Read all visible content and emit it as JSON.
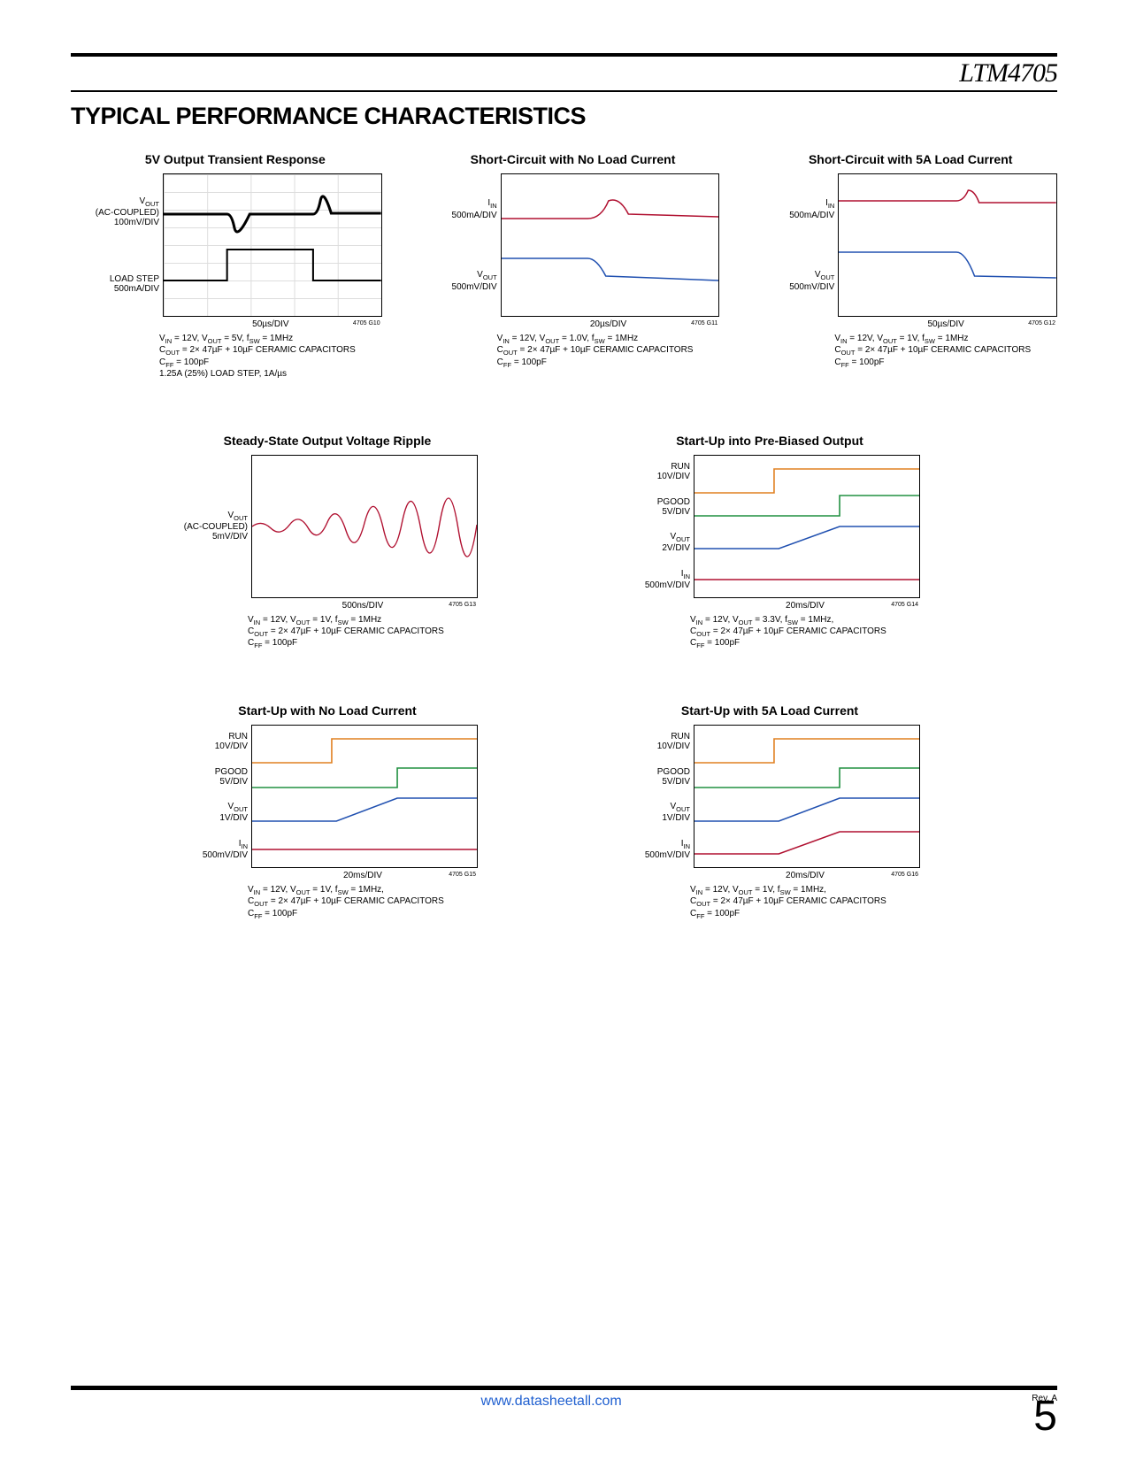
{
  "header": {
    "part": "LTM4705"
  },
  "section_title": "TYPICAL PERFORMANCE CHARACTERISTICS",
  "footer": {
    "link": "www.datasheetall.com",
    "rev": "Rev. A",
    "page": "5"
  },
  "charts": [
    {
      "title": "5V Output Transient Response",
      "y": [
        {
          "t": "V<sub>OUT</sub><br>(AC-COUPLED)<br>100mV/DIV"
        },
        {
          "t": "LOAD STEP<br>500mA/DIV"
        }
      ],
      "x": "50µs/DIV",
      "fid": "4705 G10",
      "cond": "V<sub>IN</sub> = 12V, V<sub>OUT</sub> = 5V, f<sub>SW</sub> = 1MHz<br>C<sub>OUT</sub> = 2× 47µF + 10µF CERAMIC CAPACITORS<br>C<sub>FF</sub> = 100pF<br>1.25A (25%) LOAD STEP, 1A/µs",
      "grid": true,
      "svg": "<path fill='none' stroke='#000' stroke-width='3' d='M0,45 L70,45 Q75,45 78,60 T95,45 L165,45 Q170,45 173,30 T185,44 L240,44'/><path fill='none' stroke='#000' stroke-width='2' d='M0,120 L70,120 L70,85 L165,85 L165,120 L240,120'/>"
    },
    {
      "title": "Short-Circuit with No Load Current",
      "y": [
        {
          "t": "I<sub>IN</sub><br>500mA/DIV"
        },
        {
          "t": "V<sub>OUT</sub><br>500mV/DIV"
        }
      ],
      "x": "20µs/DIV",
      "fid": "4705 G11",
      "cond": "V<sub>IN</sub> = 12V, V<sub>OUT</sub> = 1.0V, f<sub>SW</sub> = 1MHz<br>C<sub>OUT</sub> = 2× 47µF + 10µF CERAMIC CAPACITORS<br>C<sub>FF</sub> = 100pF",
      "svg": "<path fill='none' stroke='#B01030' stroke-width='1.5' d='M0,50 L95,50 Q110,50 118,30 Q130,25 140,45 L240,48'/><path fill='none' stroke='#2050B0' stroke-width='1.5' d='M0,95 L95,95 Q105,95 115,115 L240,120'/>"
    },
    {
      "title": "Short-Circuit with 5A Load Current",
      "y": [
        {
          "t": "I<sub>IN</sub><br>500mA/DIV"
        },
        {
          "t": "V<sub>OUT</sub><br>500mV/DIV"
        }
      ],
      "x": "50µs/DIV",
      "fid": "4705 G12",
      "cond": "V<sub>IN</sub> = 12V, V<sub>OUT</sub> = 1V, f<sub>SW</sub> = 1MHz<br>C<sub>OUT</sub> = 2× 47µF + 10µF CERAMIC CAPACITORS<br>C<sub>FF</sub> = 100pF",
      "svg": "<path fill='none' stroke='#B01030' stroke-width='1.5' d='M0,30 L130,30 Q138,30 143,18 Q150,18 155,32 L240,32'/><path fill='none' stroke='#2050B0' stroke-width='1.5' d='M0,88 L130,88 Q140,88 150,115 L240,117'/>"
    },
    {
      "title": "Steady-State Output Voltage Ripple",
      "y": [
        {
          "t": "V<sub>OUT</sub><br>(AC-COUPLED)<br>5mV/DIV"
        }
      ],
      "x": "500ns/DIV",
      "fid": "4705 G13",
      "cond": "V<sub>IN</sub> = 12V, V<sub>OUT</sub> = 1V, f<sub>SW</sub> = 1MHz<br>C<sub>OUT</sub> = 2× 47µF + 10µF CERAMIC CAPACITORS<br>C<sub>FF</sub> = 100pF",
      "svg": "<path fill='none' stroke='#B01030' stroke-width='1.3' d='M0,80 Q10,72 20,82 T40,78 T60,82 T80,76 T100,84 T120,76 T140,82 T160,76 T180,82 T200,78 T220,82 T240,78'/>"
    },
    {
      "title": "Start-Up into Pre-Biased Output",
      "y": [
        {
          "t": "RUN<br>10V/DIV"
        },
        {
          "t": "PGOOD<br>5V/DIV"
        },
        {
          "t": "V<sub>OUT</sub><br>2V/DIV"
        },
        {
          "t": "I<sub>IN</sub><br>500mV/DIV"
        }
      ],
      "x": "20ms/DIV",
      "fid": "4705 G14",
      "cond": "V<sub>IN</sub> = 12V, V<sub>OUT</sub> = 3.3V, f<sub>SW</sub> = 1MHz,<br>C<sub>OUT</sub> = 2× 47µF + 10µF CERAMIC CAPACITORS<br>C<sub>FF</sub> = 100pF",
      "svg": "<path fill='none' stroke='#E08020' stroke-width='1.5' d='M0,42 L85,42 L85,15 L240,15'/><path fill='none' stroke='#209040' stroke-width='1.5' d='M0,68 L155,68 L155,45 L240,45'/><path fill='none' stroke='#2050B0' stroke-width='1.5' d='M0,105 L90,105 L155,80 L240,80'/><path fill='none' stroke='#B01030' stroke-width='1.5' d='M0,140 L240,140'/>"
    },
    {
      "title": "Start-Up with No Load Current",
      "y": [
        {
          "t": "RUN<br>10V/DIV"
        },
        {
          "t": "PGOOD<br>5V/DIV"
        },
        {
          "t": "V<sub>OUT</sub><br>1V/DIV"
        },
        {
          "t": "I<sub>IN</sub><br>500mV/DIV"
        }
      ],
      "x": "20ms/DIV",
      "fid": "4705 G15",
      "cond": "V<sub>IN</sub> = 12V, V<sub>OUT</sub> = 1V, f<sub>SW</sub> = 1MHz,<br>C<sub>OUT</sub> = 2× 47µF + 10µF CERAMIC CAPACITORS<br>C<sub>FF</sub> = 100pF",
      "svg": "<path fill='none' stroke='#E08020' stroke-width='1.5' d='M0,42 L85,42 L85,15 L240,15'/><path fill='none' stroke='#209040' stroke-width='1.5' d='M0,70 L155,70 L155,48 L240,48'/><path fill='none' stroke='#2050B0' stroke-width='1.5' d='M0,108 L90,108 L155,82 L240,82'/><path fill='none' stroke='#B01030' stroke-width='1.5' d='M0,140 L240,140'/>"
    },
    {
      "title": "Start-Up with 5A Load Current",
      "y": [
        {
          "t": "RUN<br>10V/DIV"
        },
        {
          "t": "PGOOD<br>5V/DIV"
        },
        {
          "t": "V<sub>OUT</sub><br>1V/DIV"
        },
        {
          "t": "I<sub>IN</sub><br>500mV/DIV"
        }
      ],
      "x": "20ms/DIV",
      "fid": "4705 G16",
      "cond": "V<sub>IN</sub> = 12V, V<sub>OUT</sub> = 1V, f<sub>SW</sub> = 1MHz,<br>C<sub>OUT</sub> = 2× 47µF + 10µF CERAMIC CAPACITORS<br>C<sub>FF</sub> = 100pF",
      "svg": "<path fill='none' stroke='#E08020' stroke-width='1.5' d='M0,42 L85,42 L85,15 L240,15'/><path fill='none' stroke='#209040' stroke-width='1.5' d='M0,70 L155,70 L155,48 L240,48'/><path fill='none' stroke='#2050B0' stroke-width='1.5' d='M0,108 L90,108 L155,82 L240,82'/><path fill='none' stroke='#B01030' stroke-width='1.5' d='M0,145 L90,145 L155,120 L240,120'/>"
    }
  ],
  "chart_data": [
    {
      "type": "line",
      "title": "5V Output Transient Response",
      "xlabel": "50µs/DIV",
      "series": [
        {
          "name": "VOUT (AC-COUPLED) 100mV/DIV",
          "y_baseline": 0,
          "dip_mV": -100,
          "overshoot_mV": 70
        },
        {
          "name": "LOAD STEP 500mA/DIV",
          "y_low": 0,
          "y_high": 1.25,
          "unit": "A"
        }
      ],
      "conditions": {
        "VIN": "12V",
        "VOUT": "5V",
        "fSW": "1MHz",
        "COUT": "2×47µF+10µF ceramic",
        "CFF": "100pF",
        "load_step": "1.25A (25%) 1A/µs"
      }
    },
    {
      "type": "line",
      "title": "Short-Circuit with No Load Current",
      "xlabel": "20µs/DIV",
      "series": [
        {
          "name": "IIN 500mA/DIV"
        },
        {
          "name": "VOUT 500mV/DIV"
        }
      ],
      "conditions": {
        "VIN": "12V",
        "VOUT": "1.0V",
        "fSW": "1MHz",
        "COUT": "2×47µF+10µF ceramic",
        "CFF": "100pF"
      }
    },
    {
      "type": "line",
      "title": "Short-Circuit with 5A Load Current",
      "xlabel": "50µs/DIV",
      "series": [
        {
          "name": "IIN 500mA/DIV"
        },
        {
          "name": "VOUT 500mV/DIV"
        }
      ],
      "conditions": {
        "VIN": "12V",
        "VOUT": "1V",
        "fSW": "1MHz",
        "COUT": "2×47µF+10µF ceramic",
        "CFF": "100pF"
      }
    },
    {
      "type": "line",
      "title": "Steady-State Output Voltage Ripple",
      "xlabel": "500ns/DIV",
      "series": [
        {
          "name": "VOUT (AC-COUPLED) 5mV/DIV",
          "ripple_pp_mV": 10
        }
      ],
      "conditions": {
        "VIN": "12V",
        "VOUT": "1V",
        "fSW": "1MHz",
        "COUT": "2×47µF+10µF ceramic",
        "CFF": "100pF"
      }
    },
    {
      "type": "line",
      "title": "Start-Up into Pre-Biased Output",
      "xlabel": "20ms/DIV",
      "series": [
        {
          "name": "RUN 10V/DIV"
        },
        {
          "name": "PGOOD 5V/DIV"
        },
        {
          "name": "VOUT 2V/DIV"
        },
        {
          "name": "IIN 500mV/DIV"
        }
      ],
      "conditions": {
        "VIN": "12V",
        "VOUT": "3.3V",
        "fSW": "1MHz",
        "COUT": "2×47µF+10µF ceramic",
        "CFF": "100pF"
      }
    },
    {
      "type": "line",
      "title": "Start-Up with No Load Current",
      "xlabel": "20ms/DIV",
      "series": [
        {
          "name": "RUN 10V/DIV"
        },
        {
          "name": "PGOOD 5V/DIV"
        },
        {
          "name": "VOUT 1V/DIV"
        },
        {
          "name": "IIN 500mV/DIV"
        }
      ],
      "conditions": {
        "VIN": "12V",
        "VOUT": "1V",
        "fSW": "1MHz",
        "COUT": "2×47µF+10µF ceramic",
        "CFF": "100pF"
      }
    },
    {
      "type": "line",
      "title": "Start-Up with 5A Load Current",
      "xlabel": "20ms/DIV",
      "series": [
        {
          "name": "RUN 10V/DIV"
        },
        {
          "name": "PGOOD 5V/DIV"
        },
        {
          "name": "VOUT 1V/DIV"
        },
        {
          "name": "IIN 500mV/DIV"
        }
      ],
      "conditions": {
        "VIN": "12V",
        "VOUT": "1V",
        "fSW": "1MHz",
        "COUT": "2×47µF+10µF ceramic",
        "CFF": "100pF"
      }
    }
  ]
}
